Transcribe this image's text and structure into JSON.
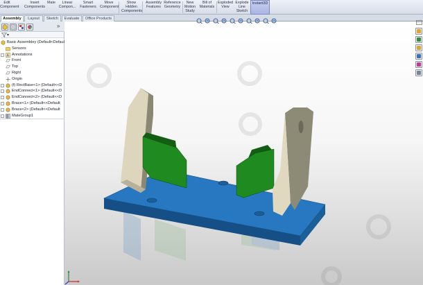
{
  "ribbon": {
    "buttons": [
      {
        "name": "edit-component-button",
        "lines": [
          "Edit",
          "Component"
        ],
        "selected": false
      },
      {
        "name": "insert-components-button",
        "lines": [
          "Insert",
          "Components"
        ],
        "selected": false
      },
      {
        "name": "mate-button",
        "lines": [
          "Mate"
        ],
        "selected": false
      },
      {
        "name": "linear-component-pattern-button",
        "lines": [
          "Linear",
          "Compon..."
        ],
        "selected": false
      },
      {
        "name": "smart-fasteners-button",
        "lines": [
          "Smart",
          "Fasteners"
        ],
        "selected": false
      },
      {
        "name": "move-component-button",
        "lines": [
          "Move",
          "Component"
        ],
        "selected": false
      },
      {
        "name": "show-hidden-components-button",
        "lines": [
          "Show",
          "Hidden",
          "Components"
        ],
        "selected": false
      },
      {
        "name": "assembly-features-button",
        "lines": [
          "Assembly",
          "Features"
        ],
        "selected": false
      },
      {
        "name": "reference-geometry-button",
        "lines": [
          "Reference",
          "Geometry"
        ],
        "selected": false
      },
      {
        "name": "new-motion-study-button",
        "lines": [
          "New",
          "Motion",
          "Study"
        ],
        "selected": false
      },
      {
        "name": "bill-of-materials-button",
        "lines": [
          "Bill of",
          "Materials"
        ],
        "selected": false
      },
      {
        "name": "exploded-view-button",
        "lines": [
          "Exploded",
          "View"
        ],
        "selected": false
      },
      {
        "name": "explode-line-sketch-button",
        "lines": [
          "Explode",
          "Line",
          "Sketch"
        ],
        "selected": false
      },
      {
        "name": "instant3d-button",
        "lines": [
          "Instant3D"
        ],
        "selected": true
      }
    ]
  },
  "tabs": [
    {
      "label": "Assembly",
      "active": true
    },
    {
      "label": "Layout",
      "active": false
    },
    {
      "label": "Sketch",
      "active": false
    },
    {
      "label": "Evaluate",
      "active": false
    },
    {
      "label": "Office Products",
      "active": false
    }
  ],
  "feature_manager": {
    "expand_glyph": "»",
    "filter_glyph": "▾",
    "tree": [
      {
        "label": "Basic Assembley  (Default<Default",
        "indent": 0,
        "icon": "assembly-icon",
        "expander": false
      },
      {
        "label": "Sensors",
        "indent": 1,
        "icon": "sensors-folder-icon",
        "expander": false
      },
      {
        "label": "Annotations",
        "indent": 1,
        "icon": "annotations-icon",
        "expander": true
      },
      {
        "label": "Front",
        "indent": 1,
        "icon": "plane-icon",
        "expander": false
      },
      {
        "label": "Top",
        "indent": 1,
        "icon": "plane-icon",
        "expander": false
      },
      {
        "label": "Right",
        "indent": 1,
        "icon": "plane-icon",
        "expander": false
      },
      {
        "label": "Origin",
        "indent": 1,
        "icon": "origin-icon",
        "expander": false
      },
      {
        "label": "(f) RectBase<1> (Default<<D",
        "indent": 1,
        "icon": "part-icon",
        "expander": true
      },
      {
        "label": "EndConnect<1> (Default<<D",
        "indent": 1,
        "icon": "part-icon",
        "expander": true
      },
      {
        "label": "EndConnect<2> (Default<<D",
        "indent": 1,
        "icon": "part-icon",
        "expander": true
      },
      {
        "label": "Brace<1> (Default<<Default",
        "indent": 1,
        "icon": "part-icon",
        "expander": true
      },
      {
        "label": "Brace<2> (Default<<Default",
        "indent": 1,
        "icon": "part-icon",
        "expander": true
      },
      {
        "label": "MateGroup1",
        "indent": 1,
        "icon": "mates-icon",
        "expander": true
      }
    ]
  },
  "hud": {
    "icons": [
      "zoom-to-fit-icon",
      "zoom-to-area-icon",
      "previous-view-icon",
      "section-view-icon",
      "view-orientation-icon",
      "display-style-icon",
      "hide-show-items-icon",
      "edit-appearance-icon",
      "apply-scene-icon",
      "view-settings-icon"
    ]
  },
  "task_pane": {
    "icons": [
      "solidworks-resources-icon",
      "design-library-icon",
      "file-explorer-icon",
      "view-palette-icon",
      "appearances-icon",
      "custom-properties-icon"
    ]
  },
  "colors": {
    "base": "#1f6fb0",
    "base_top": "#2b86cc",
    "brace": "#1f8a1f",
    "brace_dark": "#125c12",
    "endconnect": "#e3dcc4",
    "endconnect_dark": "#8d8a76",
    "ribbon_selected": "#a9b6e3"
  }
}
